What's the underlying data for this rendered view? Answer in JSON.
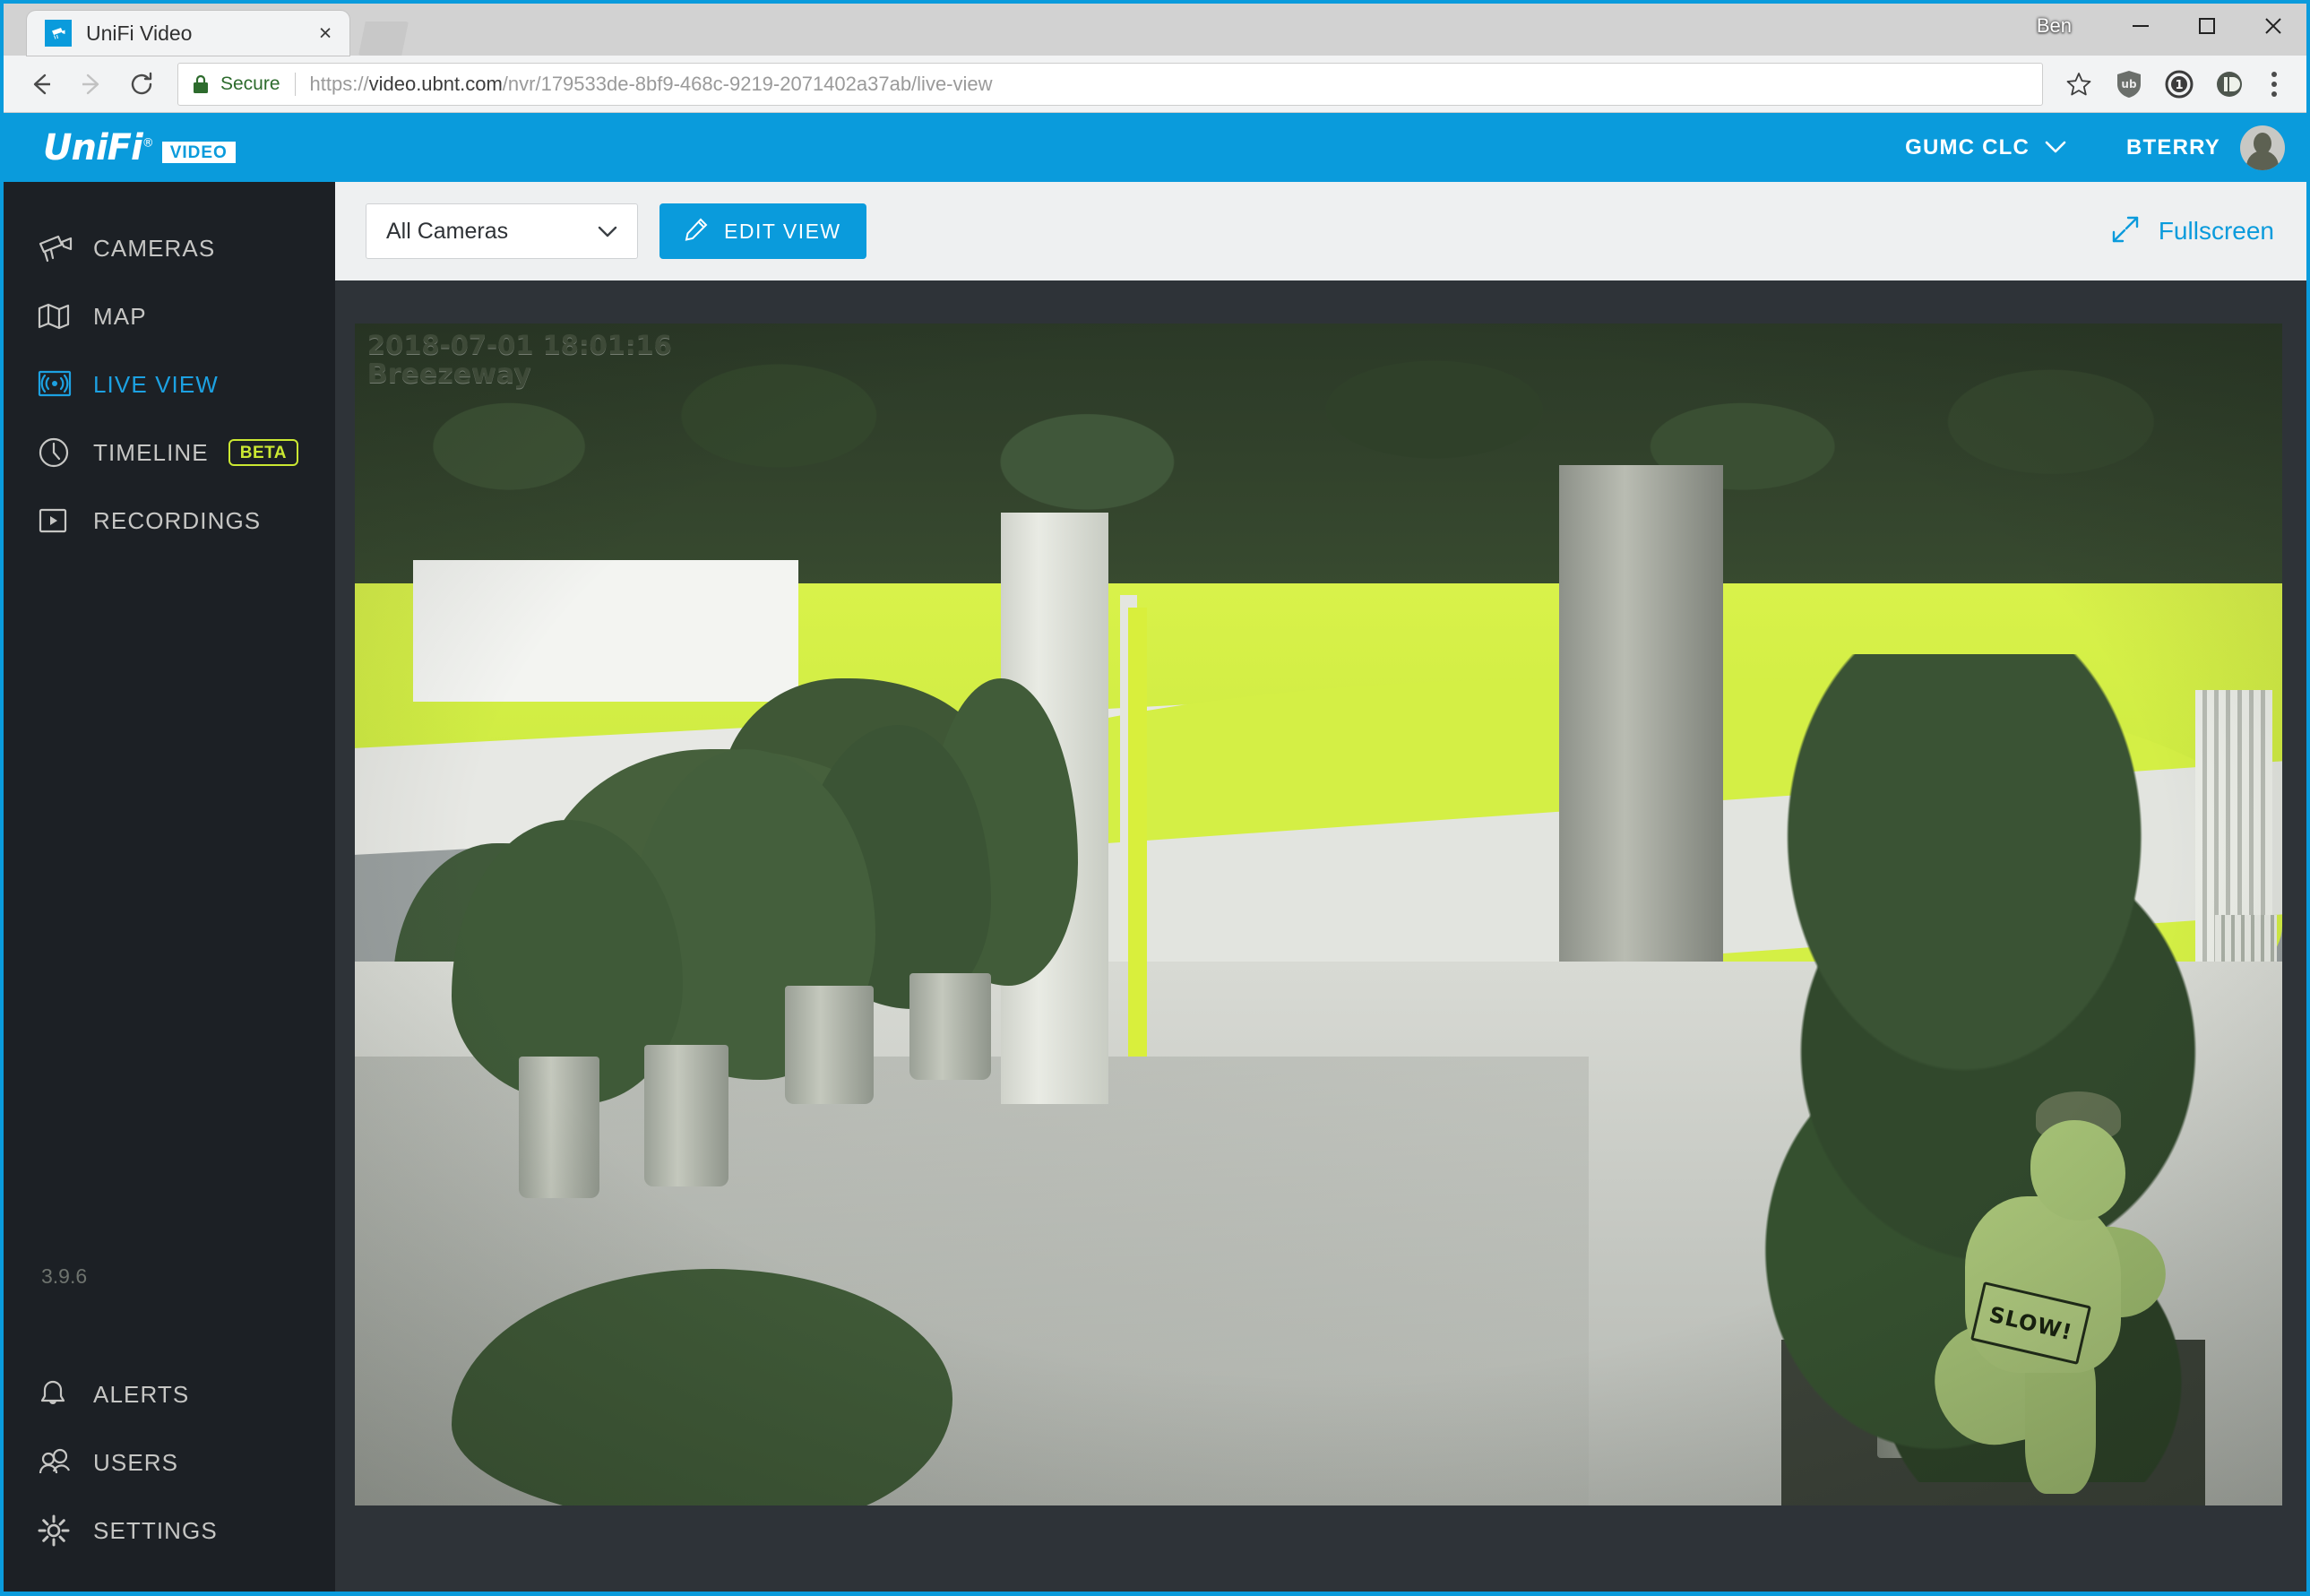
{
  "window": {
    "profile_name": "Ben",
    "minimize_label": "Minimize",
    "maximize_label": "Maximize",
    "close_label": "Close"
  },
  "browser": {
    "tab": {
      "title": "UniFi Video",
      "close_label": "×"
    },
    "new_tab_label": "New Tab",
    "back_label": "Back",
    "forward_label": "Forward",
    "reload_label": "Reload",
    "security": {
      "label": "Secure"
    },
    "url": {
      "scheme": "https://",
      "host": "video.ubnt.com",
      "path": "/nvr/179533de-8bf9-468c-9219-2071402a37ab/live-view",
      "full": "https://video.ubnt.com/nvr/179533de-8bf9-468c-9219-2071402a37ab/live-view"
    },
    "extensions": [
      {
        "name": "ublock-origin"
      },
      {
        "name": "1password"
      },
      {
        "name": "pushbullet"
      }
    ]
  },
  "app": {
    "logo": {
      "word": "UniFi",
      "registered": "®",
      "badge": "VIDEO"
    },
    "header": {
      "site_name": "GUMC CLC",
      "user_name": "BTERRY"
    },
    "sidebar": {
      "items": [
        {
          "label": "CAMERAS",
          "icon": "camera-icon",
          "active": false,
          "badge": null
        },
        {
          "label": "MAP",
          "icon": "map-icon",
          "active": false,
          "badge": null
        },
        {
          "label": "LIVE VIEW",
          "icon": "live-view-icon",
          "active": true,
          "badge": null
        },
        {
          "label": "TIMELINE",
          "icon": "clock-icon",
          "active": false,
          "badge": "BETA"
        },
        {
          "label": "RECORDINGS",
          "icon": "play-icon",
          "active": false,
          "badge": null
        }
      ],
      "bottom_items": [
        {
          "label": "ALERTS",
          "icon": "bell-icon"
        },
        {
          "label": "USERS",
          "icon": "users-icon"
        },
        {
          "label": "SETTINGS",
          "icon": "gear-icon"
        }
      ],
      "version": "3.9.6"
    },
    "toolbar": {
      "camera_filter_value": "All Cameras",
      "edit_view_label": "EDIT VIEW",
      "fullscreen_label": "Fullscreen"
    },
    "video": {
      "timestamp": "2018-07-01 18:01:16",
      "camera_name": "Breezeway",
      "sign_text": "SLOW!"
    }
  },
  "colors": {
    "brand_blue": "#0a9bdc",
    "sidebar_bg": "#1c2025",
    "active_blue": "#1ca1e2",
    "beta_green": "#cbe832",
    "stage_bg": "#2e3338",
    "secure_green": "#2d6b2d"
  }
}
